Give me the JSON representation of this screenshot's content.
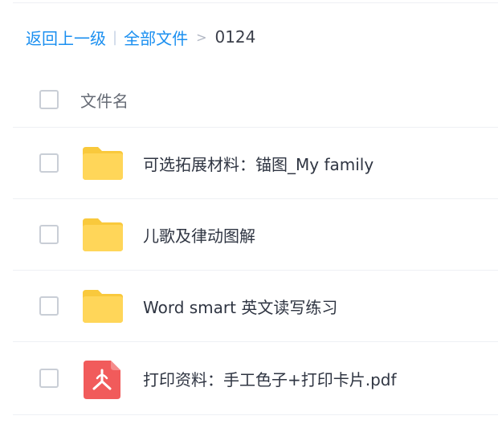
{
  "breadcrumb": {
    "back_label": "返回上一级",
    "separator": "|",
    "all_files_label": "全部文件",
    "arrow": ">",
    "current": "0124"
  },
  "list": {
    "header_label": "文件名",
    "items": [
      {
        "name": "可选拓展材料：锚图_My family",
        "type": "folder",
        "icon": "folder-icon"
      },
      {
        "name": "儿歌及律动图解",
        "type": "folder",
        "icon": "folder-icon"
      },
      {
        "name": "Word smart 英文读写练习",
        "type": "folder",
        "icon": "folder-icon"
      },
      {
        "name": "打印资料：手工色子+打印卡片.pdf",
        "type": "pdf",
        "icon": "pdf-icon"
      }
    ]
  },
  "colors": {
    "link": "#1a8ff0",
    "folder": "#ffd659",
    "pdf": "#f15b5b"
  }
}
